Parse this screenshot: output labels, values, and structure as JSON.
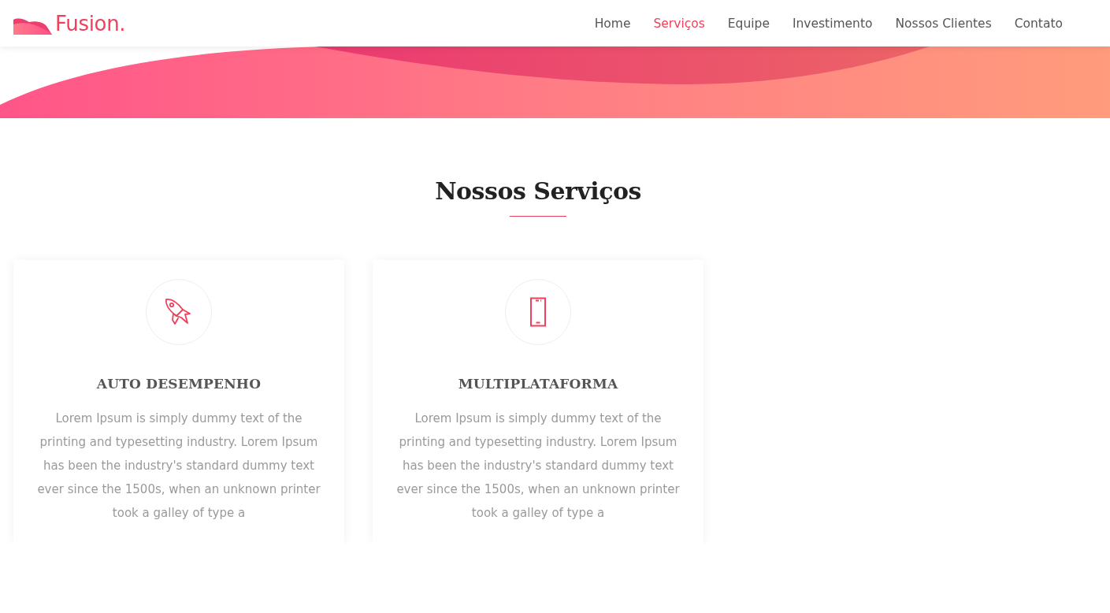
{
  "header": {
    "logo": "Fusion.",
    "nav": [
      {
        "label": "Home",
        "selected": false
      },
      {
        "label": "Serviços",
        "selected": true
      },
      {
        "label": "Equipe",
        "selected": false
      },
      {
        "label": "Investimento",
        "selected": false
      },
      {
        "label": "Nossos Clientes",
        "selected": false
      },
      {
        "label": "Contato",
        "selected": false
      }
    ]
  },
  "section": {
    "title": "Nossos Serviços",
    "services": [
      {
        "kind": "rocket",
        "title": "AUTO DESEMPENHO",
        "text": "Lorem Ipsum is simply dummy text of the printing and typesetting industry. Lorem Ipsum has been the industry's standard dummy text ever since the 1500s, when an unknown printer took a galley of type a"
      },
      {
        "kind": "mobile",
        "title": "MULTIPLATAFORMA",
        "text": "Lorem Ipsum is simply dummy text of the printing and typesetting industry. Lorem Ipsum has been the industry's standard dummy text ever since the 1500s, when an unknown printer took a galley of type a"
      }
    ]
  }
}
